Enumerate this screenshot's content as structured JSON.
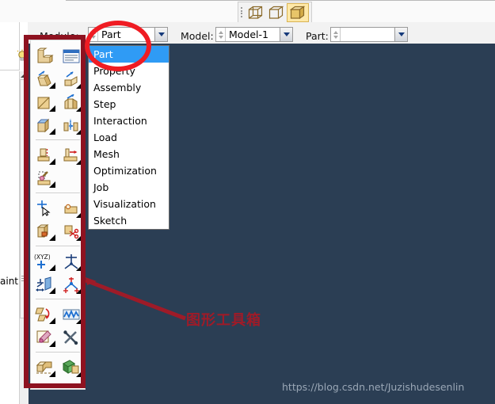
{
  "app": {
    "canvas_color": "#2b3e54",
    "chrome_color": "#f2f2f2"
  },
  "top_toolbar": {
    "render_group_name": "render-style-toolbar",
    "buttons": [
      {
        "icon": "wireframe-cube-icon",
        "label": "Wireframe",
        "selected": false
      },
      {
        "icon": "hidden-line-cube-icon",
        "label": "Hidden",
        "selected": false
      },
      {
        "icon": "shaded-cube-icon",
        "label": "Shaded",
        "selected": true
      }
    ]
  },
  "module_bar": {
    "module_label": "Module:",
    "module_value": "Part",
    "model_label": "Model:",
    "model_value": "Model-1",
    "part_label": "Part:",
    "part_value": ""
  },
  "module_dropdown": {
    "open": true,
    "selected": "Part",
    "items": [
      "Part",
      "Property",
      "Assembly",
      "Step",
      "Interaction",
      "Load",
      "Mesh",
      "Optimization",
      "Job",
      "Visualization",
      "Sketch"
    ]
  },
  "left_panel": {
    "bulb_icon": "light-bulb-icon",
    "partial_text": "aint"
  },
  "toolbox": {
    "name": "part-module-toolbox",
    "groups": [
      {
        "rows": [
          [
            {
              "icon": "create-part-icon"
            },
            {
              "icon": "part-manager-icon"
            }
          ],
          [
            {
              "icon": "create-solid-extrude-icon"
            },
            {
              "icon": "create-shell-extrude-icon"
            }
          ],
          [
            {
              "icon": "create-solid-revolve-icon"
            },
            {
              "icon": "create-shell-sweep-icon"
            }
          ],
          [
            {
              "icon": "create-solid-loft-icon"
            },
            {
              "icon": "create-blend-icon"
            }
          ]
        ]
      },
      {
        "rows": [
          [
            {
              "icon": "create-cut-extrude-icon"
            },
            {
              "icon": "create-cut-sweep-icon"
            }
          ],
          [
            {
              "icon": "create-round-fillet-icon"
            }
          ]
        ]
      },
      {
        "rows": [
          [
            {
              "icon": "create-point-icon"
            },
            {
              "icon": "create-wire-icon"
            }
          ],
          [
            {
              "icon": "partition-cell-icon"
            },
            {
              "icon": "partition-face-sketch-icon"
            }
          ]
        ]
      },
      {
        "rows": [
          [
            {
              "icon": "create-datum-point-icon"
            },
            {
              "icon": "create-datum-axis-icon"
            }
          ],
          [
            {
              "icon": "create-datum-plane-icon"
            },
            {
              "icon": "create-datum-csys-icon"
            }
          ]
        ]
      },
      {
        "rows": [
          [
            {
              "icon": "create-feature-pattern-icon"
            },
            {
              "icon": "edit-feature-icon"
            }
          ],
          [
            {
              "icon": "create-sketch-icon"
            },
            {
              "icon": "query-tools-icon"
            }
          ]
        ]
      },
      {
        "rows": [
          [
            {
              "icon": "create-geometry-set-icon"
            },
            {
              "icon": "merge-cut-instances-icon"
            }
          ]
        ]
      }
    ]
  },
  "annotations": {
    "box_color": "#8e1220",
    "ellipse_color": "#ef1c23",
    "arrow_color": "#9e1b28",
    "label_text": "图形工具箱",
    "watermark": "https://blog.csdn.net/Juzishudesenlin"
  }
}
